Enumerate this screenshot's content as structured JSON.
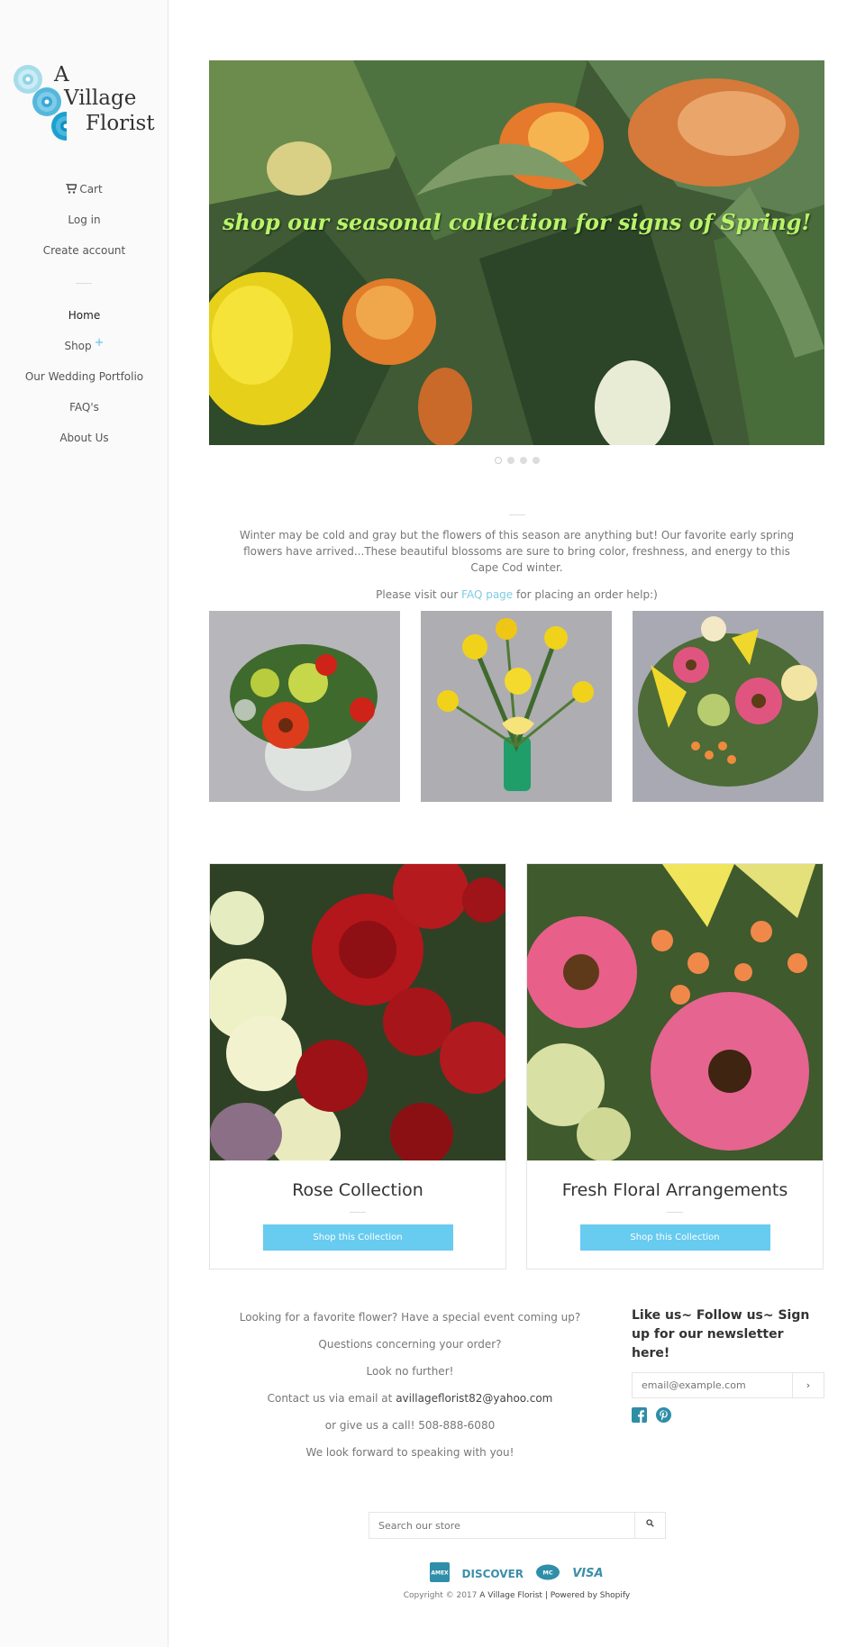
{
  "brand": {
    "line1": "A",
    "line2": "Village",
    "line3": "Florist",
    "accent": "#5bc3e6"
  },
  "sidebar": {
    "account": [
      {
        "label": "Cart",
        "icon": "cart-icon"
      },
      {
        "label": "Log in"
      },
      {
        "label": "Create account"
      }
    ],
    "nav": [
      {
        "label": "Home"
      },
      {
        "label": "Shop"
      },
      {
        "label": "Our Wedding Portfolio"
      },
      {
        "label": "FAQ's"
      },
      {
        "label": "About Us"
      }
    ]
  },
  "hero": {
    "caption": "shop our seasonal collection for signs of Spring!",
    "slide_count": 4,
    "active_slide": 1
  },
  "intro": {
    "paragraph": "Winter may be cold and gray but the flowers of this season are anything but! Our favorite early spring flowers have arrived...These beautiful blossoms are sure to bring color, freshness, and energy to this Cape Cod winter.",
    "visit_prefix": "Please visit our",
    "visit_link": "FAQ page",
    "visit_suffix": "for placing an order help:)"
  },
  "collections": [
    {
      "title": "Rose Collection",
      "button": "Shop this Collection"
    },
    {
      "title": "Fresh Floral Arrangements",
      "button": "Shop this Collection"
    }
  ],
  "contact": {
    "line1": "Looking for a favorite flower? Have a special event coming up?",
    "line2": "Questions concerning your order?",
    "line3": "Look no further!",
    "email_prefix": "Contact us via email at",
    "email": "avillageflorist82@yahoo.com",
    "phone_prefix": "or give us a call!",
    "phone": "508-888-6080",
    "line6": "We look forward to speaking with you!"
  },
  "newsletter": {
    "heading": "Like us~ Follow us~ Sign up for our newsletter here!",
    "placeholder": "email@example.com",
    "submit": "›"
  },
  "search": {
    "placeholder": "Search our store"
  },
  "payments": {
    "discover": "DISCOVER",
    "visa": "VISA",
    "amex": "AMEX",
    "mastercard": "MC"
  },
  "footer": {
    "copyright": "Copyright © 2017",
    "store": "A Village Florist",
    "powered": "| Powered by Shopify"
  }
}
